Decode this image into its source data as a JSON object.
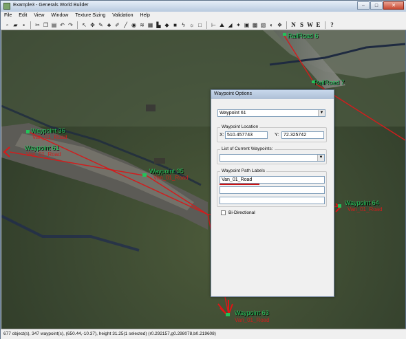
{
  "window": {
    "title": "Example3 - Generals World Builder",
    "controls": [
      "–",
      "□",
      "✕"
    ]
  },
  "menu": [
    "File",
    "Edit",
    "View",
    "Window",
    "Texture Sizing",
    "Validation",
    "Help"
  ],
  "toolbar": {
    "icons": [
      "new-icon",
      "open-icon",
      "save-icon",
      "cut-icon",
      "copy-icon",
      "paste-icon",
      "undo-icon",
      "redo-icon",
      "select-icon",
      "move-icon",
      "brush-icon",
      "grove-icon",
      "feather-icon",
      "road-icon",
      "waypoint-icon",
      "water-icon",
      "mesh-icon",
      "flatten-icon",
      "fill-icon",
      "square-icon",
      "lightning-icon",
      "light-icon",
      "rect-icon",
      "build-list-icon",
      "terrain-icon",
      "ramp-icon",
      "scorch-icon",
      "border-icon",
      "grid-icon",
      "image-icon",
      "camera-icon",
      "object-icon"
    ],
    "compass": [
      "N",
      "S",
      "W",
      "E"
    ],
    "help_glyph": "?"
  },
  "viewport": {
    "waypoints": [
      {
        "label": "Waypoint 36",
        "path": "Van_01_Road"
      },
      {
        "label": "Waypoint 61",
        "path": "Van_01_Road"
      },
      {
        "label": "Waypoint 35",
        "path": "Van_01_Road"
      },
      {
        "label": "Waypoint 64",
        "path": "Van_01_Road"
      },
      {
        "label": "Waypoint 63",
        "path": "Van_01_Road"
      }
    ],
    "railroads": [
      "RailRoad 6",
      "RailRoad 7"
    ]
  },
  "dialog": {
    "title": "Waypoint Options",
    "waypoint_name": "Waypoint 61",
    "location_title": "Waypoint Location",
    "x_label": "X:",
    "x_value": "510.457743",
    "y_label": "Y:",
    "y_value": "72.325742",
    "current_waypoints_title": "List of Current Waypoints:",
    "current_waypoints_value": "",
    "path_labels_title": "Waypoint Path Labels",
    "path_labels": [
      "Van_01_Road",
      "",
      ""
    ],
    "bidirectional_label": "Bi-Directional",
    "bidirectional_checked": false
  },
  "status": {
    "text": "677 object(s), 347 waypoint(s), (650.44,-10.37), height 31.25(1 selected) (r0.292157,g0.298078,b0.219608)"
  },
  "colors": {
    "waypoint_label": "#22c35a",
    "path_label": "#d11d1d",
    "path_line": "#d11d1d"
  }
}
